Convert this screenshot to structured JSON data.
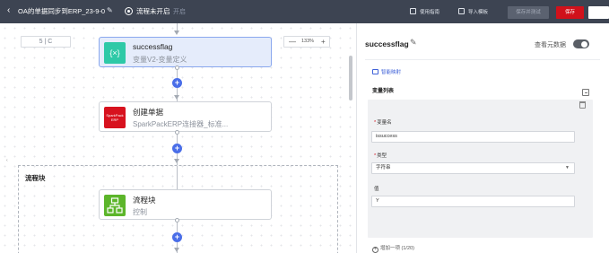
{
  "header": {
    "back_icon": "chevron-left-icon",
    "flow_title": "OA的单据同步到ERP_23-9-0",
    "status_text": "流程未开启",
    "status_toggle": "开启",
    "guide_label": "使用指南",
    "import_label": "导入模板",
    "save_test_label": "保存并测试",
    "save_label": "保存",
    "save_color": "#d0111b"
  },
  "canvas": {
    "undo_controls": "5 | C",
    "zoom_minus": "—",
    "zoom_level": "133%",
    "zoom_plus": "+",
    "nodes": [
      {
        "title": "successflag",
        "subtitle": "变量V2-变量定义",
        "icon": "variable-braces-icon",
        "icon_text": "{×}",
        "icon_color": "#2ec9a7"
      },
      {
        "title": "创建单据",
        "subtitle": "SparkPackERP连接器_标准...",
        "icon": "sparkpack-logo-icon",
        "icon_text": "SparkPack\nERP",
        "icon_color": "#d7121e"
      }
    ],
    "block_title": "流程块",
    "block_node": {
      "title": "流程块",
      "subtitle": "控制",
      "icon": "flow-block-icon",
      "icon_color": "#5cb52a"
    },
    "left_marker": "‹",
    "plus_label": "+"
  },
  "panel": {
    "title": "successflag",
    "meta_label": "查看元数据",
    "smart_mapping": "智能映射",
    "section_title": "变量列表",
    "var_name_label": "变量名",
    "var_name_value": "issuccess",
    "type_label": "类型",
    "type_value": "字符串",
    "value_label": "值",
    "value_value": "Y",
    "add_label": "增加一项 (1/20)",
    "accent_color": "#3f62d8"
  }
}
